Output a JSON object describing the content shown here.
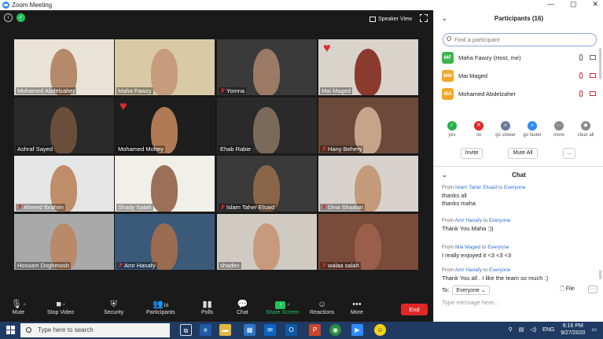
{
  "window": {
    "title": "Zoom Meeting",
    "speaker_view_label": "Speaker View"
  },
  "participants_tiles": [
    {
      "name": "Mohamed Abdelzaher",
      "muted": false,
      "active": false,
      "heart": false
    },
    {
      "name": "Maha Fawzy",
      "muted": false,
      "active": true,
      "heart": false
    },
    {
      "name": "Yomna",
      "muted": true,
      "active": false,
      "heart": false
    },
    {
      "name": "Mai Maged",
      "muted": false,
      "active": false,
      "heart": true
    },
    {
      "name": "Ashraf Sayed",
      "muted": false,
      "active": false,
      "heart": false
    },
    {
      "name": "Mohamed Mohey",
      "muted": false,
      "active": false,
      "heart": true
    },
    {
      "name": "Ehab Rabie",
      "muted": false,
      "active": false,
      "heart": false
    },
    {
      "name": "Hany Behery",
      "muted": true,
      "active": false,
      "heart": false
    },
    {
      "name": "Ahmed Ibrahim",
      "muted": true,
      "active": false,
      "heart": false
    },
    {
      "name": "Shady Salah",
      "muted": false,
      "active": false,
      "heart": false
    },
    {
      "name": "Islam Taher Elsaid",
      "muted": true,
      "active": false,
      "heart": false
    },
    {
      "name": "Dina Shaalan",
      "muted": true,
      "active": false,
      "heart": false
    },
    {
      "name": "Hossam Doghmosh",
      "muted": false,
      "active": false,
      "heart": false
    },
    {
      "name": "Amr Hanafy",
      "muted": true,
      "active": false,
      "heart": false
    },
    {
      "name": "shaden",
      "muted": false,
      "active": false,
      "heart": false
    },
    {
      "name": "walaa salah",
      "muted": true,
      "active": false,
      "heart": false
    }
  ],
  "toolbar": {
    "mute": "Mute",
    "stop_video": "Stop Video",
    "security": "Security",
    "participants": "Participants",
    "participants_count": "16",
    "polls": "Polls",
    "chat": "Chat",
    "share_screen": "Share Screen",
    "reactions": "Reactions",
    "more": "More",
    "end": "End"
  },
  "panel": {
    "participants_title": "Participants (16)",
    "find_placeholder": "Find a participant",
    "list": [
      {
        "initials": "MF",
        "name": "Maha Fawzy (Host, me)",
        "color": "#3bb54a"
      },
      {
        "initials": "MM",
        "name": "Mai Maged",
        "color": "#f5a623"
      },
      {
        "initials": "MA",
        "name": "Mohamed Abdelzaher",
        "color": "#f5a623"
      }
    ],
    "reactions": [
      {
        "label": "yes",
        "color": "#23b14d",
        "glyph": "✓"
      },
      {
        "label": "no",
        "color": "#e02828",
        "glyph": "✕"
      },
      {
        "label": "go slower",
        "color": "#6b7a99",
        "glyph": "«"
      },
      {
        "label": "go faster",
        "color": "#2d8cff",
        "glyph": "»"
      },
      {
        "label": "more",
        "color": "#8a8a8a",
        "glyph": "···"
      },
      {
        "label": "clear all",
        "color": "#8a8a8a",
        "glyph": "◆"
      }
    ],
    "invite": "Invite",
    "mute_all": "Mute All",
    "more_btn": "...",
    "chat_title": "Chat",
    "messages": [
      {
        "from": "Islam Taher Elsaid",
        "to": "Everyone",
        "lines": [
          "thanks all",
          "thanks maha"
        ]
      },
      {
        "from": "Amr Hanafy",
        "to": "Everyone",
        "lines": [
          "Thank You Maha :))"
        ]
      },
      {
        "from": "Mai Maged",
        "to": "Everyone",
        "lines": [
          "I really enjoyed it <3 <3 <3"
        ]
      },
      {
        "from": "Amr Hanafy",
        "to": "Everyone",
        "lines": [
          "Thank You all . I like the team so much :)"
        ]
      }
    ],
    "from_label": "From",
    "to_label": "to",
    "to_prefix": "To:",
    "to_value": "Everyone",
    "file_label": "File",
    "type_placeholder": "Type message here..."
  },
  "taskbar": {
    "search_placeholder": "Type here to search",
    "lang": "ENG",
    "time": "6:16 PM",
    "date": "9/27/2020"
  }
}
